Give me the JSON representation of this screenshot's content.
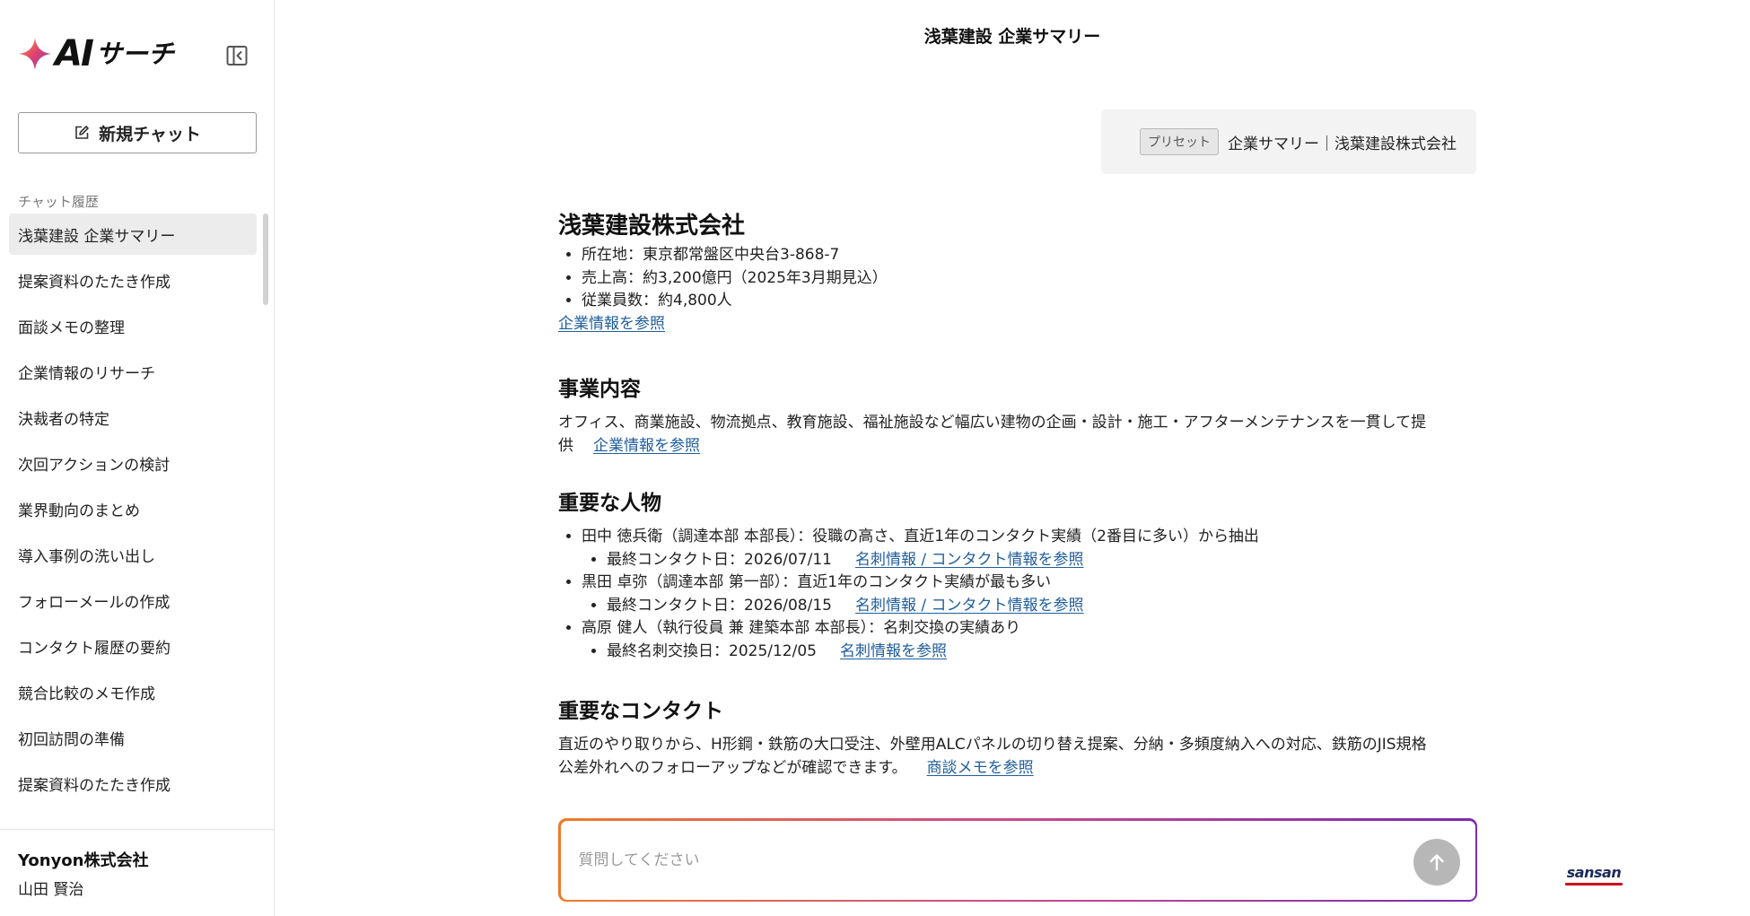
{
  "brand": {
    "ai": "AI",
    "sub": "サーチ"
  },
  "sidebar": {
    "new_chat_label": "新規チャット",
    "history_label": "チャット履歴",
    "items": [
      "浅葉建設 企業サマリー",
      "提案資料のたたき作成",
      "面談メモの整理",
      "企業情報のリサーチ",
      "決裁者の特定",
      "次回アクションの検討",
      "業界動向のまとめ",
      "導入事例の洗い出し",
      "フォローメールの作成",
      "コンタクト履歴の要約",
      "競合比較のメモ作成",
      "初回訪問の準備",
      "提案資料のたたき作成"
    ],
    "footer": {
      "company": "Yonyon株式会社",
      "user": "山田 賢治"
    }
  },
  "header": {
    "title": "浅葉建設 企業サマリー"
  },
  "preset": {
    "tag": "プリセット",
    "text": "企業サマリー｜浅葉建設株式会社"
  },
  "answer": {
    "company": {
      "title": "浅葉建設株式会社",
      "facts": [
        "所在地：東京都常盤区中央台3-868-7",
        "売上高：約3,200億円（2025年3月期見込）",
        "従業員数：約4,800人"
      ],
      "link": "企業情報を参照"
    },
    "business": {
      "heading": "事業内容",
      "text_line1": "オフィス、商業施設、物流拠点、教育施設、福祉施設など幅広い建物の企画・設計・施工・アフターメンテナンスを一貫して提",
      "text_line2": "供",
      "link": "企業情報を参照"
    },
    "people": {
      "heading": "重要な人物",
      "items": [
        {
          "text": "田中 徳兵衛（調達本部 本部長）：役職の高さ、直近1年のコンタクト実績（2番目に多い）から抽出",
          "sub": "最終コンタクト日：2026/07/11",
          "link": "名刺情報 / コンタクト情報を参照"
        },
        {
          "text": "黒田 卓弥（調達本部 第一部）：直近1年のコンタクト実績が最も多い",
          "sub": "最終コンタクト日：2026/08/15",
          "link": "名刺情報 / コンタクト情報を参照"
        },
        {
          "text": "高原 健人（執行役員 兼 建築本部 本部長）：名刺交換の実績あり",
          "sub": "最終名刺交換日：2025/12/05",
          "link": "名刺情報を参照"
        }
      ]
    },
    "contact": {
      "heading": "重要なコンタクト",
      "text_line1": "直近のやり取りから、H形鋼・鉄筋の大口受注、外壁用ALCパネルの切り替え提案、分納・多頻度納入への対応、鉄筋のJIS規格",
      "text_line2": "公差外れへのフォローアップなどが確認できます。",
      "link": "商談メモを参照"
    }
  },
  "input": {
    "placeholder": "質問してください",
    "value": ""
  },
  "footer_logo": {
    "text": "sansan"
  },
  "colors": {
    "link": "#1f5d9b",
    "gradient_start": "#f07a2a",
    "gradient_end": "#7a2bb0",
    "send_button": "#b7b7b7",
    "active_item": "#ececec",
    "logo_red": "#d0021b"
  },
  "icons": {
    "brand": "sparkle-star-icon",
    "collapse": "sidebar-collapse-icon",
    "new_chat": "edit-icon",
    "send": "arrow-up-icon"
  }
}
